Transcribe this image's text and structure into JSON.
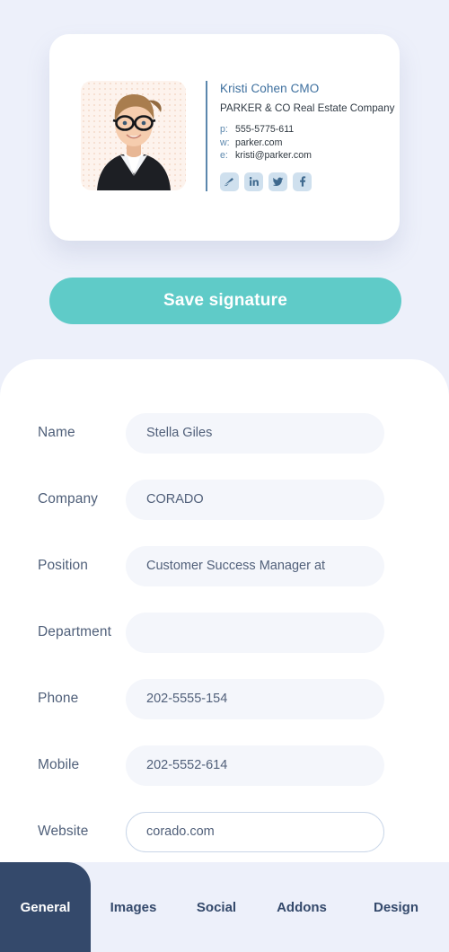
{
  "signature_card": {
    "name": "Kristi Cohen CMO",
    "company": "PARKER & CO Real Estate Company",
    "contact": [
      {
        "key": "p:",
        "value": "555-5775-611"
      },
      {
        "key": "w:",
        "value": "parker.com"
      },
      {
        "key": "e:",
        "value": "kristi@parker.com"
      }
    ],
    "socials": [
      {
        "icon": "signature-icon",
        "label": "Signature"
      },
      {
        "icon": "linkedin-icon",
        "label": "LinkedIn"
      },
      {
        "icon": "twitter-icon",
        "label": "Twitter"
      },
      {
        "icon": "facebook-icon",
        "label": "Facebook"
      }
    ],
    "portrait_alt": "Portrait of a businesswoman with glasses"
  },
  "save_button": {
    "label": "Save signature"
  },
  "form": {
    "fields": [
      {
        "label": "Name",
        "value": "Stella Giles",
        "placeholder": "",
        "focused": false
      },
      {
        "label": "Company",
        "value": "CORADO",
        "placeholder": "",
        "focused": false
      },
      {
        "label": "Position",
        "value": "Customer Success Manager at",
        "placeholder": "",
        "focused": false
      },
      {
        "label": "Department",
        "value": "",
        "placeholder": "",
        "focused": false
      },
      {
        "label": "Phone",
        "value": "202-5555-154",
        "placeholder": "",
        "focused": false
      },
      {
        "label": "Mobile",
        "value": "202-5552-614",
        "placeholder": "",
        "focused": false
      },
      {
        "label": "Website",
        "value": "corado.com",
        "placeholder": "",
        "focused": true
      }
    ]
  },
  "tabs": {
    "items": [
      {
        "label": "General",
        "active": true
      },
      {
        "label": "Images",
        "active": false
      },
      {
        "label": "Social",
        "active": false
      },
      {
        "label": "Addons",
        "active": false
      },
      {
        "label": "Design",
        "active": false
      }
    ]
  },
  "colors": {
    "page_background": "#edf0fa",
    "accent_teal": "#5fcbc8",
    "tab_active_navy": "#34496b",
    "field_background": "#f4f6fb",
    "signature_accent_blue": "#5b87ad"
  }
}
